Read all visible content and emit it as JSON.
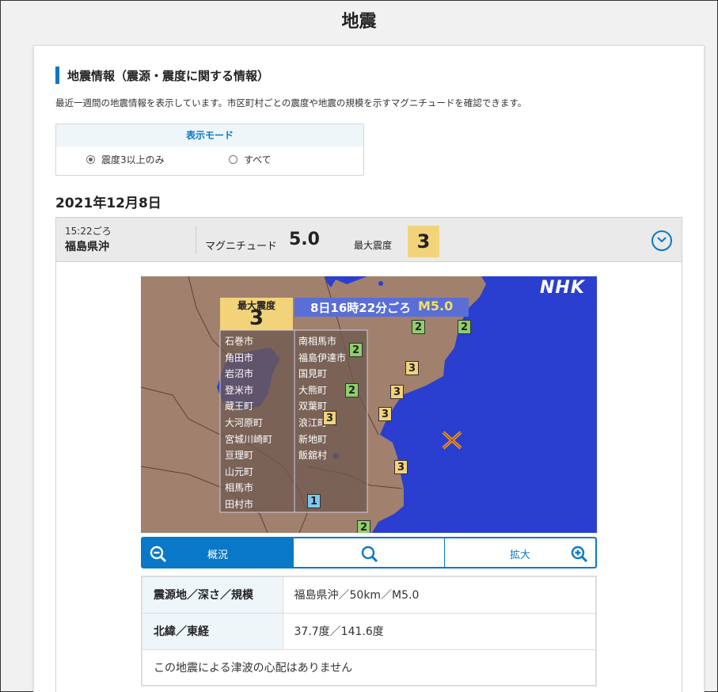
{
  "page": {
    "title": "地震"
  },
  "section": {
    "title": "地震情報（震源・震度に関する情報）",
    "description": "最近一週間の地震情報を表示しています。市区町村ごとの震度や地震の規模を示すマグニチュードを確認できます。"
  },
  "display_mode": {
    "title": "表示モード",
    "options": [
      {
        "label": "震度3以上のみ",
        "selected": true
      },
      {
        "label": "すべて",
        "selected": false
      }
    ]
  },
  "date_heading": "2021年12月8日",
  "quake": {
    "time": "15:22ごろ",
    "place": "福島県沖",
    "magnitude_label": "マグニチュード",
    "magnitude_value": "5.0",
    "max_intensity_label": "最大震度",
    "max_intensity_value": "3",
    "toggle_icon": "chevron-down-circle-icon",
    "map": {
      "logo": "NHK",
      "max_label": "最大震度",
      "max_value": "3",
      "headline": "8日16時22分ごろ",
      "magnitude": "M5.0",
      "cities_left": [
        "石巻市",
        "角田市",
        "岩沼市",
        "登米市",
        "蔵王町",
        "大河原町",
        "宮城川崎町",
        "亘理町",
        "山元町",
        "相馬市",
        "田村市"
      ],
      "cities_right": [
        "南相馬市",
        "福島伊達市",
        "国見町",
        "大熊町",
        "双葉町",
        "浪江町",
        "新地町",
        "飯舘村"
      ],
      "intensity_markers": [
        {
          "value": "2"
        },
        {
          "value": "2"
        },
        {
          "value": "2"
        },
        {
          "value": "3"
        },
        {
          "value": "2"
        },
        {
          "value": "3"
        },
        {
          "value": "3"
        },
        {
          "value": "3"
        },
        {
          "value": "3"
        },
        {
          "value": "1"
        },
        {
          "value": "2"
        }
      ],
      "colors": {
        "sea": "#2a3fcf",
        "land": "#a2806e",
        "int1": "#7fc8f0",
        "int2": "#8fcf6b",
        "int3": "#f2d37a",
        "epicenter": "#e8b020"
      }
    },
    "zoom": {
      "overview_label": "概況",
      "zoom_label": "拡大",
      "icons": [
        "zoom-out-icon",
        "search-icon",
        "zoom-in-icon"
      ]
    },
    "details": {
      "row1_key": "震源地／深さ／規模",
      "row1_val": "福島県沖／50km／M5.0",
      "row2_key": "北緯／東経",
      "row2_val": "37.7度／141.6度",
      "tsunami": "この地震による津波の心配はありません"
    }
  }
}
